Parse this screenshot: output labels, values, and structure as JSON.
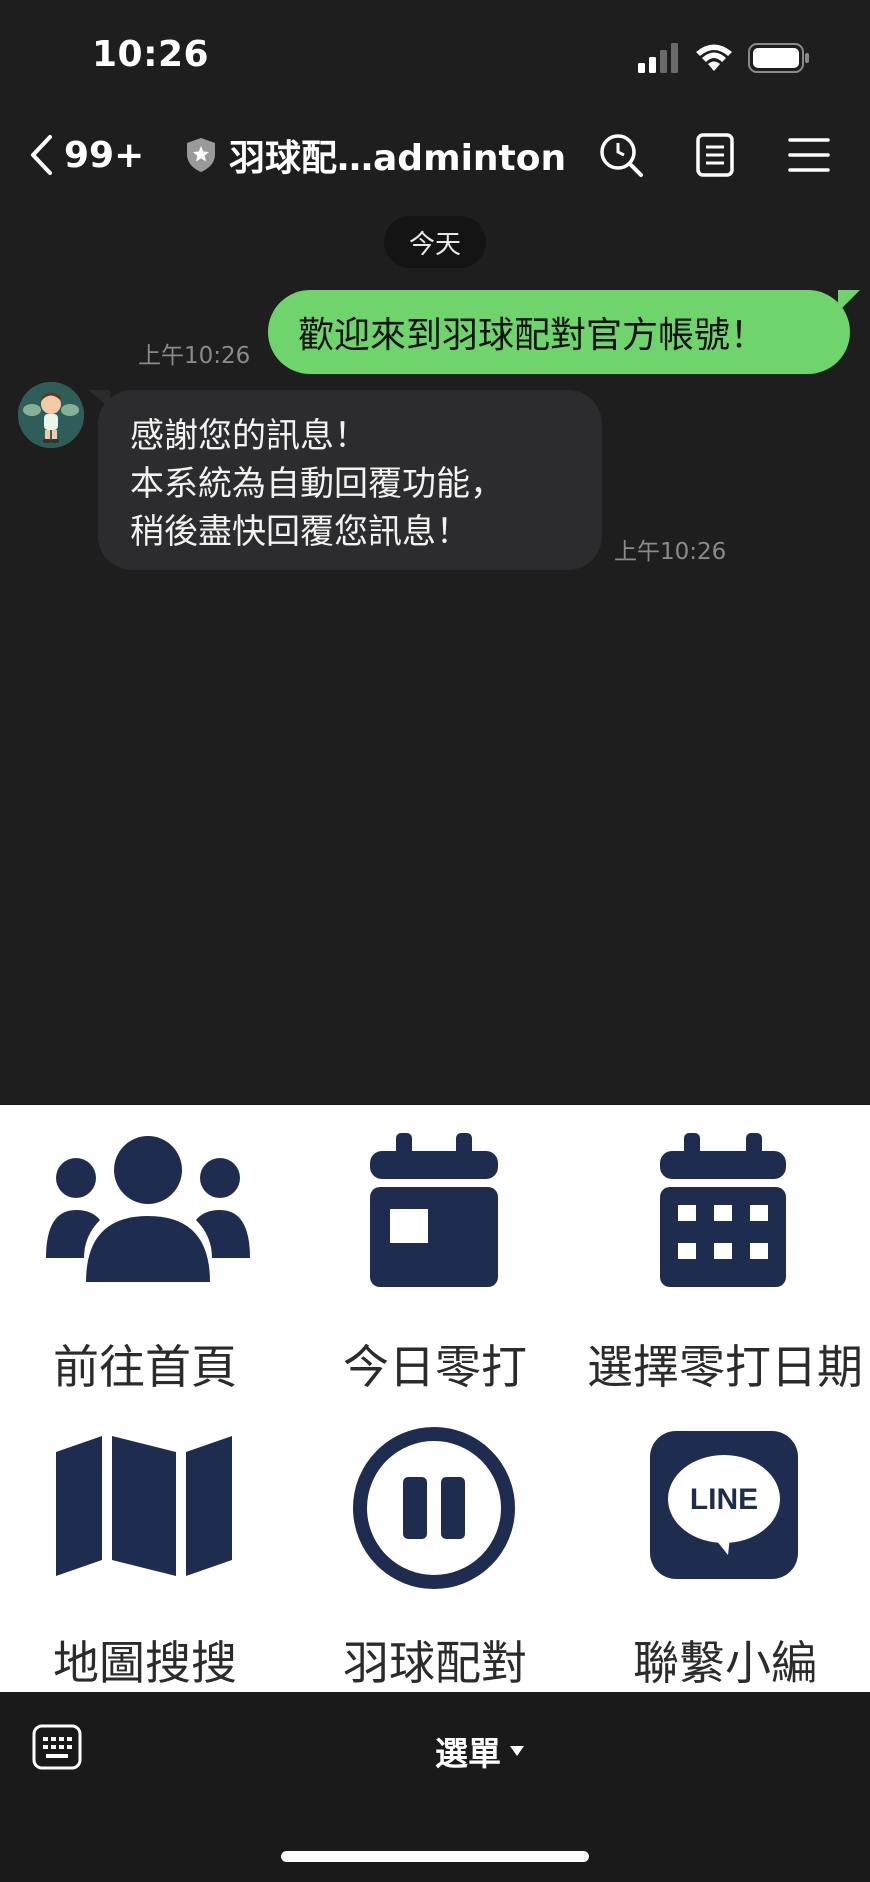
{
  "status_bar": {
    "time": "10:26"
  },
  "header": {
    "back_count": "99+",
    "title": "羽球配…adminton"
  },
  "chat": {
    "date_divider": "今天",
    "messages": [
      {
        "direction": "out",
        "text": "歡迎來到羽球配對官方帳號！",
        "time": "上午10:26"
      },
      {
        "direction": "in",
        "lines": [
          "感謝您的訊息！",
          "本系統為自動回覆功能，",
          "稍後盡快回覆您訊息！"
        ],
        "time": "上午10:26"
      }
    ]
  },
  "rich_menu": {
    "icon_color": "#1e2d4f",
    "items": [
      {
        "label": "前往首頁",
        "icon": "group-icon"
      },
      {
        "label": "今日零打",
        "icon": "calendar-day-icon"
      },
      {
        "label": "選擇零打日期",
        "icon": "calendar-grid-icon"
      },
      {
        "label": "地圖搜搜",
        "icon": "map-icon"
      },
      {
        "label": "羽球配對",
        "icon": "pause-circle-icon"
      },
      {
        "label": "聯繫小編",
        "icon": "line-logo-icon"
      }
    ],
    "line_logo_text": "LINE"
  },
  "bottom_bar": {
    "menu_label": "選單"
  },
  "colors": {
    "outgoing_bubble": "#6fd46b",
    "incoming_bubble": "#2c2c2e",
    "background": "#1e1e1f"
  }
}
